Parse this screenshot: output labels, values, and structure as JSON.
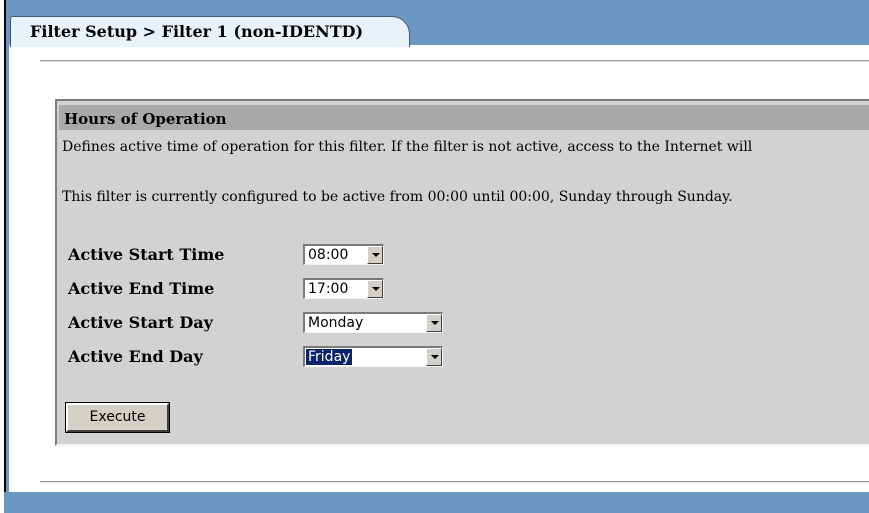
{
  "header": {
    "tab_title": "Filter Setup > Filter 1 (non-IDENTD)"
  },
  "panel": {
    "title": "Hours of Operation",
    "description": "Defines active time of operation for this filter. If the filter is not active, access to the Internet will",
    "status": "This filter is currently configured to be active from 00:00 until 00:00, Sunday through Sunday."
  },
  "form": {
    "start_time": {
      "label": "Active Start Time",
      "value": "08:00"
    },
    "end_time": {
      "label": "Active End Time",
      "value": "17:00"
    },
    "start_day": {
      "label": "Active Start Day",
      "value": "Monday"
    },
    "end_day": {
      "label": "Active End Day",
      "value": "Friday"
    }
  },
  "actions": {
    "execute_label": "Execute"
  },
  "icons": {
    "dropdown": "chevron-down-icon"
  },
  "colors": {
    "frame": "#6b98c2",
    "tab": "#e9f1f9",
    "panel": "#d2d2d2",
    "panel_header": "#a9a9a9",
    "selected_highlight": "#0a246a"
  }
}
